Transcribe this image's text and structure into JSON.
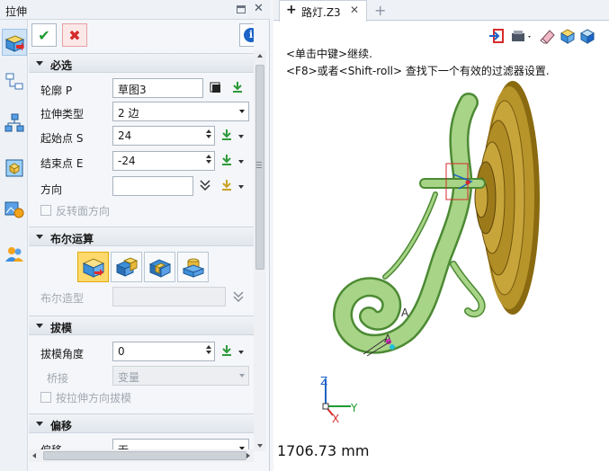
{
  "panel": {
    "title": "拉伸"
  },
  "sections": {
    "required": {
      "title": "必选",
      "profile_label": "轮廓 P",
      "profile_value": "草图3",
      "extrude_type_label": "拉伸类型",
      "extrude_type_value": "2 边",
      "start_label": "起始点 S",
      "start_value": "24",
      "end_label": "结束点 E",
      "end_value": "-24",
      "direction_label": "方向",
      "direction_value": "",
      "reverse_label": "反转面方向"
    },
    "boolean": {
      "title": "布尔运算",
      "shape_label": "布尔造型"
    },
    "draft": {
      "title": "拔模",
      "angle_label": "拔模角度",
      "angle_value": "0",
      "bridge_label": "桥接",
      "bridge_value": "变量",
      "draft_by_dir_label": "按拉伸方向拔模"
    },
    "offset": {
      "title": "偏移",
      "offset_label": "偏移",
      "offset_value": "无"
    }
  },
  "document": {
    "tab_name": "路灯.Z3",
    "hint_line1": "<单击中键>继续.",
    "hint_line2": "<F8>或者<Shift-roll> 查找下一个有效的过滤器设置.",
    "measurement": "1706.73 mm"
  },
  "triad": {
    "x": "X",
    "y": "Y",
    "z": "Z"
  },
  "model_labels": {
    "a1": "A",
    "a2": "A"
  },
  "colors": {
    "ok": "#1d9a2f",
    "cancel": "#d62b2b",
    "accent": "#1b63c6",
    "model_green": "#9ccf7a",
    "bronze": "#b8952b"
  },
  "icons": {
    "ok": "check-icon",
    "cancel": "x-icon",
    "info": "info-icon"
  }
}
